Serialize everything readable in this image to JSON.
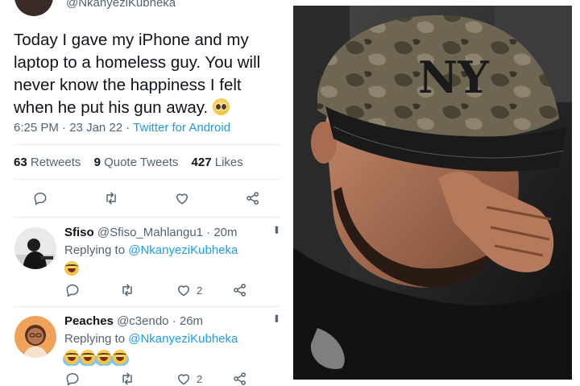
{
  "tweet": {
    "handle": "@NkanyeziKubheka",
    "text": "Today I gave my iPhone and my laptop to a homeless guy. You will never know the happiness I felt when he put his gun away.",
    "time": "6:25 PM",
    "separator": " · ",
    "date": "23 Jan 22",
    "source": "Twitter for Android",
    "retweets_count": "63",
    "retweets_label": "Retweets",
    "quote_count": "9",
    "quote_label": "Quote Tweets",
    "likes_count": "427",
    "likes_label": "Likes",
    "emoji": "pleading-face-emoji"
  },
  "replies": [
    {
      "name": "Sfiso",
      "handle": "@Sfiso_Mahlangu1",
      "time": "· 20m",
      "replying_label": "Replying to",
      "mention": "@NkanyeziKubheka",
      "emojis": [
        "grinning-squinting-face-emoji"
      ],
      "like_count": "2"
    },
    {
      "name": "Peaches",
      "handle": "@c3endo",
      "time": "· 26m",
      "replying_label": "Replying to",
      "mention": "@NkanyeziKubheka",
      "emojis": [
        "face-with-tears-of-joy-emoji",
        "face-with-tears-of-joy-emoji",
        "face-with-tears-of-joy-emoji",
        "face-with-tears-of-joy-emoji"
      ],
      "like_count": "2"
    }
  ],
  "icons": {
    "reply": "reply-icon",
    "retweet": "retweet-icon",
    "like": "heart-icon",
    "share": "share-icon",
    "more": "more-options-icon"
  },
  "colors": {
    "link": "#1d9bf0",
    "secondary_text": "#536471",
    "primary_text": "#0f1419",
    "divider": "#e6ecf0"
  },
  "photo": {
    "cap_logo_text": "NY"
  }
}
